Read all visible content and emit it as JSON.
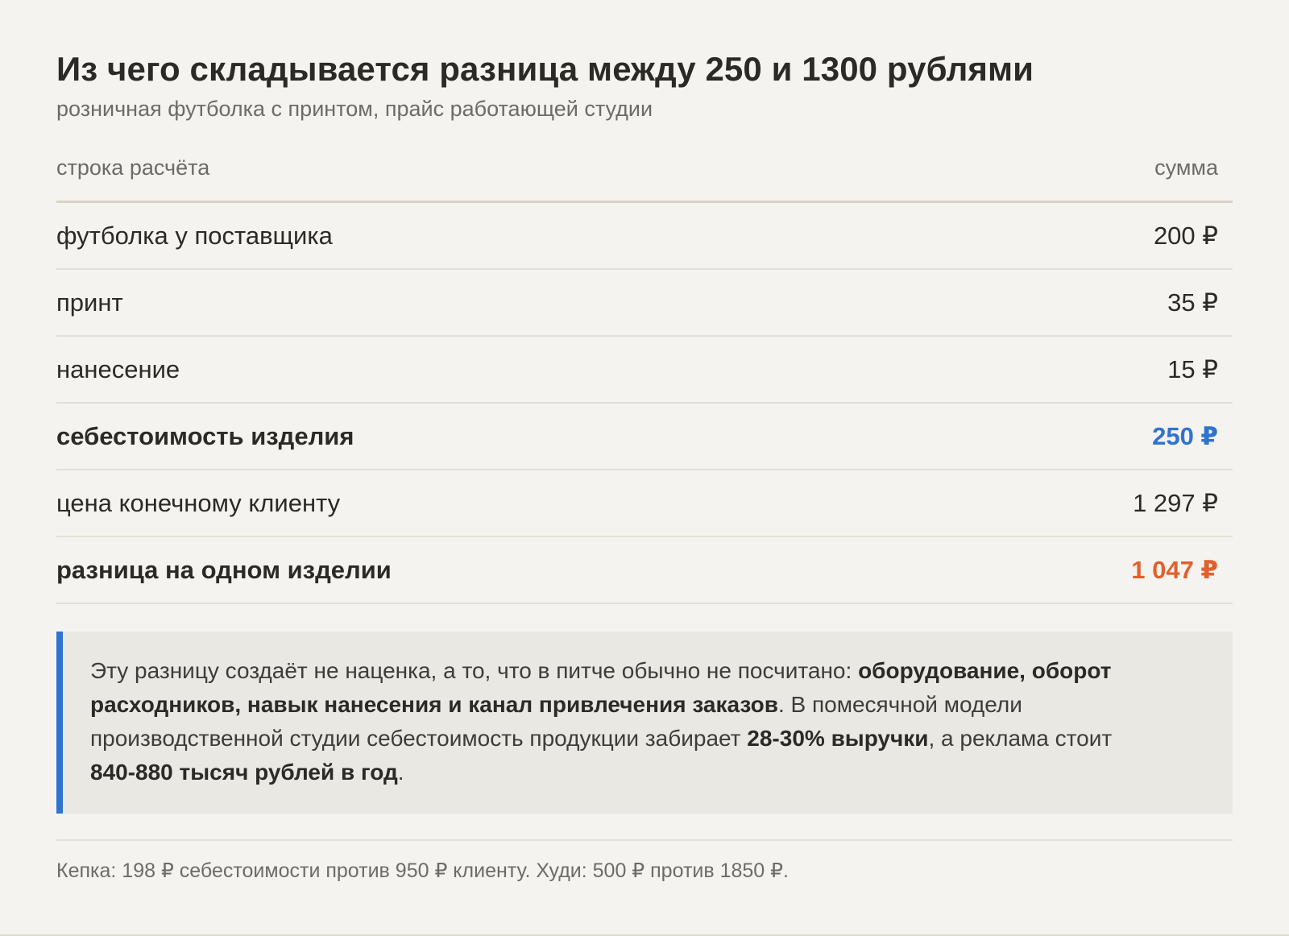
{
  "header": {
    "title": "Из чего складывается разница между 250 и 1300 рублями",
    "subtitle": "розничная футболка с принтом, прайс работающей студии"
  },
  "table": {
    "columns": [
      "строка расчёта",
      "сумма"
    ],
    "rows": [
      {
        "label": "футболка у поставщика",
        "value": "200 ₽"
      },
      {
        "label": "принт",
        "value": "35 ₽"
      },
      {
        "label": "нанесение",
        "value": "15 ₽"
      },
      {
        "label": "себестоимость изделия",
        "value": "250 ₽"
      },
      {
        "label": "цена конечному клиенту",
        "value": "1 297 ₽"
      },
      {
        "label": "разница на одном изделии",
        "value": "1 047 ₽"
      }
    ]
  },
  "note": {
    "t1": "Эту разницу создаёт не наценка, а то, что в питче обычно не посчитано: ",
    "b1": "оборудование, оборот расходников, навык нанесения и канал привлечения заказов",
    "t2": ". В помесячной модели производственной студии себестоимость продукции забирает ",
    "b2": "28-30% выручки",
    "t3": ", а реклама стоит ",
    "b3": "840-880 тысяч рублей в год",
    "t4": "."
  },
  "footer": {
    "text": "Кепка: 198 ₽ себестоимости против 950 ₽ клиенту. Худи: 500 ₽ против 1850 ₽."
  },
  "colors": {
    "accent_blue": "#2f74d0",
    "accent_orange": "#e0602e",
    "background": "#f5f3ef"
  }
}
